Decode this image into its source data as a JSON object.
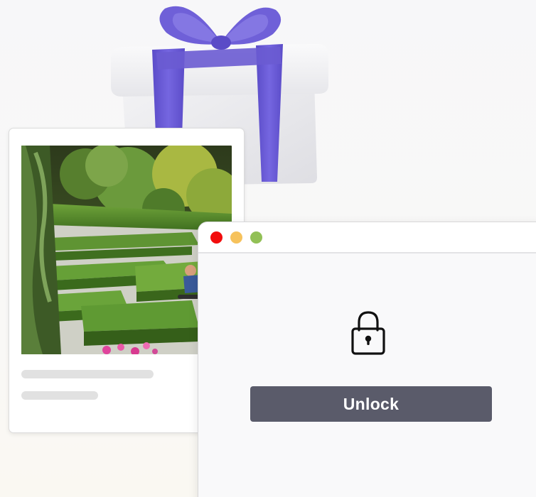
{
  "colors": {
    "window_close_dot": "#f20d0d",
    "window_minimize_dot": "#f6c25c",
    "window_zoom_dot": "#92c056",
    "unlock_button_bg": "#5a5b6a",
    "ribbon": "#6a5bd2",
    "lock_stroke": "#111111"
  },
  "icons": {
    "gift": "gift-box-illustration",
    "lock": "padlock-icon"
  },
  "window": {
    "unlock_label": "Unlock"
  }
}
